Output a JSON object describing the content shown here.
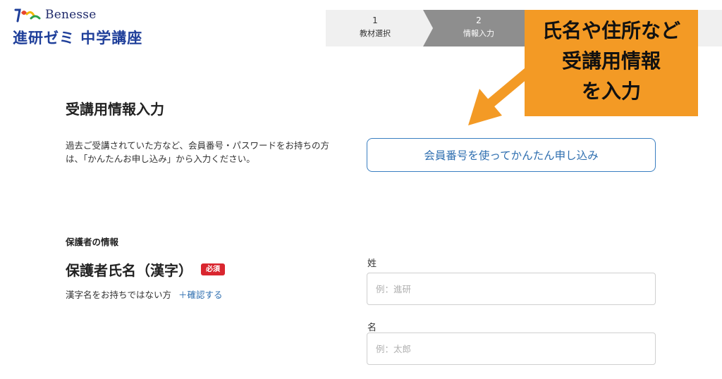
{
  "logo": {
    "brand": "Benesse",
    "course": "進研ゼミ 中学講座"
  },
  "stepper": {
    "steps": [
      {
        "number": "1",
        "label": "教材選択",
        "state": "done"
      },
      {
        "number": "2",
        "label": "情報入力",
        "state": "current"
      }
    ]
  },
  "callout": {
    "lines": [
      "氏名や住所など",
      "受講用情報",
      "を入力"
    ],
    "color": "#f39a25"
  },
  "page": {
    "title": "受講用情報入力",
    "intro": "過去ご受講されていた方など、会員番号・パスワードをお持ちの方は、「かんたんお申し込み」から入力ください。",
    "easy_button": "会員番号を使ってかんたん申し込み"
  },
  "guardian": {
    "heading": "保護者の情報",
    "name_label": "保護者氏名（漢字）",
    "required": "必須",
    "kanji_note": "漢字名をお持ちではない方",
    "confirm_link": "＋確認する",
    "last_name": {
      "label": "姓",
      "placeholder": "例：進研"
    },
    "first_name": {
      "label": "名",
      "placeholder": "例：太郎"
    }
  },
  "colors": {
    "accent_blue": "#2f6fb0",
    "required_red": "#d9262f",
    "step_active": "#8e8e8e"
  }
}
